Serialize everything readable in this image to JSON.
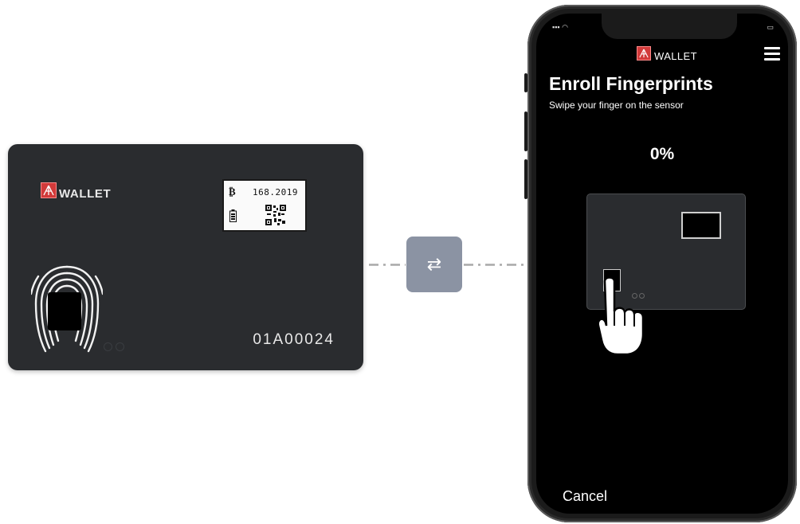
{
  "card": {
    "logo_text": "WALLET",
    "balance_symbol": "₿",
    "balance_value": "168.2019",
    "serial": "01A00024"
  },
  "connector": {
    "icon": "sync-arrows-icon",
    "glyph": "⇄",
    "color": "#8b93a3"
  },
  "phone": {
    "logo_text": "WALLET",
    "title": "Enroll Fingerprints",
    "subtitle": "Swipe your finger on the sensor",
    "progress_text": "0%",
    "progress_fraction": 0,
    "cancel_label": "Cancel"
  },
  "colors": {
    "brand_red": "#d23a3a",
    "card_body": "#2a2c2f",
    "screen_bg": "#000000"
  }
}
